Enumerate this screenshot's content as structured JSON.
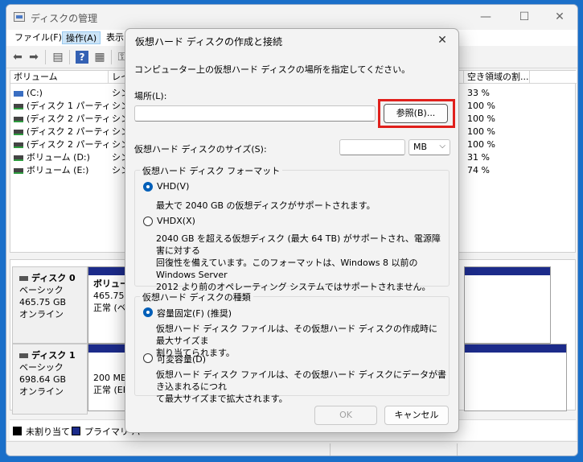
{
  "window": {
    "title": "ディスクの管理",
    "controls": [
      "—",
      "☐",
      "✕"
    ]
  },
  "menubar": [
    {
      "label": "ファイル(F)"
    },
    {
      "label": "操作(A)"
    },
    {
      "label": "表示"
    }
  ],
  "volume_list": {
    "headers": [
      "ボリューム",
      "レイ",
      "空き領域の割..."
    ],
    "rows": [
      {
        "name": "(C:)",
        "layout": "シン",
        "free_pct": "33 %"
      },
      {
        "name": "(ディスク 1 パーティシ...",
        "layout": "シン",
        "free_pct": "100 %"
      },
      {
        "name": "(ディスク 2 パーティシ...",
        "layout": "シン",
        "free_pct": "100 %"
      },
      {
        "name": "(ディスク 2 パーティシ...",
        "layout": "シン",
        "free_pct": "100 %"
      },
      {
        "name": "(ディスク 2 パーティシ...",
        "layout": "シン",
        "free_pct": "100 %"
      },
      {
        "name": "ボリューム (D:)",
        "layout": "シン",
        "free_pct": "31 %"
      },
      {
        "name": "ボリューム (E:)",
        "layout": "シン",
        "free_pct": "74 %"
      }
    ]
  },
  "disks": [
    {
      "name": "ディスク 0",
      "type": "ベーシック",
      "size": "465.75 GB",
      "status": "オンライン",
      "partition": {
        "line1": "ボリューム",
        "line2": "465.75 GB",
        "line3": "正常 (ベー"
      }
    },
    {
      "name": "ディスク 1",
      "type": "ベーシック",
      "size": "698.64 GB",
      "status": "オンライン",
      "partition": {
        "line1": "",
        "line2": "200 MB",
        "line3": "正常 (EFI"
      }
    }
  ],
  "legend": [
    {
      "label": "未割り当て",
      "color": "#000000"
    },
    {
      "label": "プライマリ パ",
      "color": "#1c2b8a"
    }
  ],
  "dialog": {
    "title": "仮想ハード ディスクの作成と接続",
    "instruction": "コンピューター上の仮想ハード ディスクの場所を指定してください。",
    "location_label": "場所(L):",
    "location_value": "",
    "browse_button": "参照(B)...",
    "size_label": "仮想ハード ディスクのサイズ(S):",
    "size_value": "",
    "size_unit": "MB",
    "format_group": {
      "title": "仮想ハード ディスク フォーマット",
      "vhd_label": "VHD(V)",
      "vhd_desc": "最大で 2040 GB の仮想ディスクがサポートされます。",
      "vhdx_label": "VHDX(X)",
      "vhdx_desc": [
        "2040 GB を超える仮想ディスク (最大 64 TB) がサポートされ、電源障害に対する",
        "回復性を備えています。このフォーマットは、Windows 8 以前の Windows Server",
        "2012 より前のオペレーティング システムではサポートされません。"
      ]
    },
    "type_group": {
      "title": "仮想ハード ディスクの種類",
      "fixed_label": "容量固定(F) (推奨)",
      "fixed_desc": [
        "仮想ハード ディスク ファイルは、その仮想ハード ディスクの作成時に最大サイズま",
        "割り当てられます。"
      ],
      "dynamic_label": "可変容量(D)",
      "dynamic_desc": [
        "仮想ハード ディスク ファイルは、その仮想ハード ディスクにデータが書き込まれるにつれ",
        "て最大サイズまで拡大されます。"
      ]
    },
    "ok_button": "OK",
    "cancel_button": "キャンセル",
    "close_glyph": "✕"
  },
  "colors": {
    "highlight": "#e0201c",
    "primary_partition": "#1c2b8a",
    "radio_selected": "#005fb8"
  }
}
